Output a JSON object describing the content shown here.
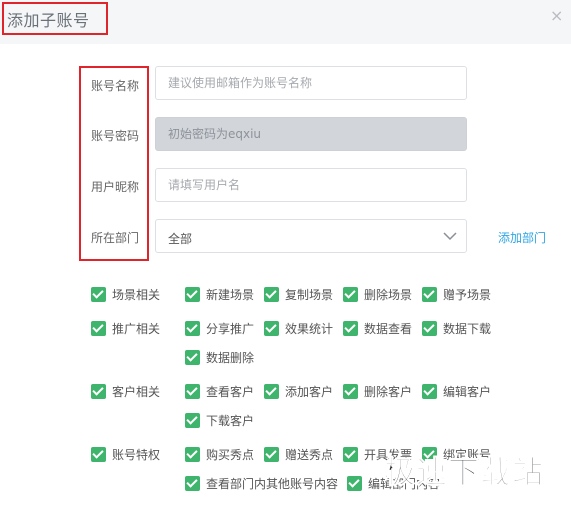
{
  "dialog": {
    "title": "添加子账号",
    "close_label": "×"
  },
  "form": {
    "account_name": {
      "label": "账号名称",
      "placeholder": "建议使用邮箱作为账号名称"
    },
    "password": {
      "label": "账号密码",
      "placeholder": "初始密码为eqxiu"
    },
    "nickname": {
      "label": "用户昵称",
      "placeholder": "请填写用户名"
    },
    "department": {
      "label": "所在部门",
      "selected": "全部",
      "add_link": "添加部门"
    }
  },
  "permissions": {
    "scene": [
      "场景相关",
      "新建场景",
      "复制场景",
      "删除场景",
      "赠予场景"
    ],
    "promotion": [
      "推广相关",
      "分享推广",
      "效果统计",
      "数据查看",
      "数据下载",
      "数据删除"
    ],
    "customer": [
      "客户相关",
      "查看客户",
      "添加客户",
      "删除客户",
      "编辑客户",
      "下载客户"
    ],
    "account": [
      "账号特权",
      "购买秀点",
      "赠送秀点",
      "开具发票",
      "绑定账号",
      "查看部门内其他账号内容",
      "编辑部门内容"
    ]
  },
  "checkbox_color": "#3eb46c",
  "link_color": "#2fa6e6",
  "watermark": "极速下载站"
}
